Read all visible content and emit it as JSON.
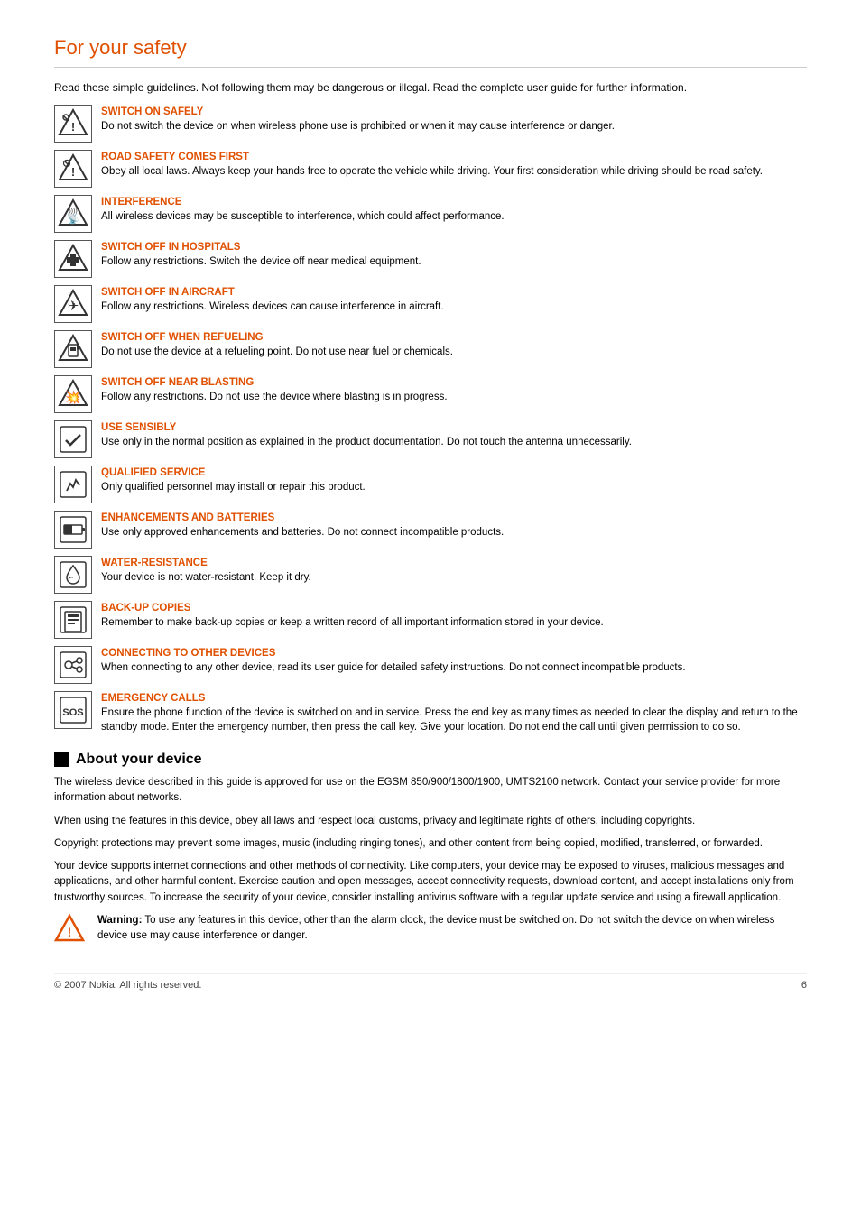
{
  "page": {
    "title": "For your safety",
    "intro": "Read these simple guidelines. Not following them may be dangerous or illegal. Read the complete user guide for further information.",
    "safety_items": [
      {
        "id": "switch-on-safely",
        "title": "SWITCH ON SAFELY",
        "desc": "Do not switch the device on when wireless phone use is prohibited or when it may cause interference or danger.",
        "icon": "phone-prohibited"
      },
      {
        "id": "road-safety",
        "title": "ROAD SAFETY COMES FIRST",
        "desc": "Obey all local laws. Always keep your hands free to operate the vehicle while driving. Your first consideration while driving should be road safety.",
        "icon": "road"
      },
      {
        "id": "interference",
        "title": "INTERFERENCE",
        "desc": "All wireless devices may be susceptible to interference, which could affect performance.",
        "icon": "interference"
      },
      {
        "id": "hospitals",
        "title": "SWITCH OFF IN HOSPITALS",
        "desc": "Follow any restrictions. Switch the device off near medical equipment.",
        "icon": "hospital"
      },
      {
        "id": "aircraft",
        "title": "SWITCH OFF IN AIRCRAFT",
        "desc": "Follow any restrictions. Wireless devices can cause interference in aircraft.",
        "icon": "aircraft"
      },
      {
        "id": "refueling",
        "title": "SWITCH OFF WHEN REFUELING",
        "desc": "Do not use the device at a refueling point. Do not use near fuel or chemicals.",
        "icon": "fuel"
      },
      {
        "id": "blasting",
        "title": "SWITCH OFF NEAR BLASTING",
        "desc": "Follow any restrictions. Do not use the device where blasting is in progress.",
        "icon": "blasting"
      },
      {
        "id": "use-sensibly",
        "title": "USE SENSIBLY",
        "desc": "Use only in the normal position as explained in the product documentation. Do not touch the antenna unnecessarily.",
        "icon": "sensibly"
      },
      {
        "id": "qualified-service",
        "title": "QUALIFIED SERVICE",
        "desc": "Only qualified personnel may install or repair this product.",
        "icon": "service"
      },
      {
        "id": "enhancements",
        "title": "ENHANCEMENTS AND BATTERIES",
        "desc": "Use only approved enhancements and batteries. Do not connect incompatible products.",
        "icon": "battery"
      },
      {
        "id": "water-resistance",
        "title": "WATER-RESISTANCE",
        "desc": "Your device is not water-resistant. Keep it dry.",
        "icon": "water"
      },
      {
        "id": "backup",
        "title": "BACK-UP COPIES",
        "desc": "Remember to make back-up copies or keep a written record of all important information stored in your device.",
        "icon": "backup"
      },
      {
        "id": "connecting",
        "title": "CONNECTING TO OTHER DEVICES",
        "desc": "When connecting to any other device, read its user guide for detailed safety instructions. Do not connect incompatible products.",
        "icon": "connecting"
      },
      {
        "id": "emergency",
        "title": "EMERGENCY CALLS",
        "desc": "Ensure the phone function of the device is switched on and in service. Press the end key as many times as needed to clear the display and return to the standby mode. Enter the emergency number, then press the call key. Give your location. Do not end the call until given permission to do so.",
        "icon": "sos"
      }
    ],
    "about_section": {
      "heading": "About your device",
      "paragraphs": [
        "The wireless device described in this guide is approved for use on the EGSM 850/900/1800/1900, UMTS2100 network. Contact your service provider for more information about networks.",
        "When using the features in this device, obey all laws and respect local customs, privacy and legitimate rights of others, including copyrights.",
        "Copyright protections may prevent some images, music (including ringing tones), and other content from being copied, modified, transferred, or forwarded.",
        "Your device supports internet connections and other methods of connectivity. Like computers, your device may be exposed to viruses, malicious messages and applications, and other harmful content. Exercise caution and open messages, accept connectivity requests, download content, and accept installations only from trustworthy sources. To increase the security of your device, consider installing antivirus software with a regular update service and using a firewall application."
      ],
      "warning_label": "Warning:",
      "warning_text": "To use any features in this device, other than the alarm clock, the device must be switched on. Do not switch the device on when wireless device use may cause interference or danger."
    },
    "footer": {
      "copyright": "© 2007 Nokia. All rights reserved.",
      "page_number": "6"
    }
  }
}
